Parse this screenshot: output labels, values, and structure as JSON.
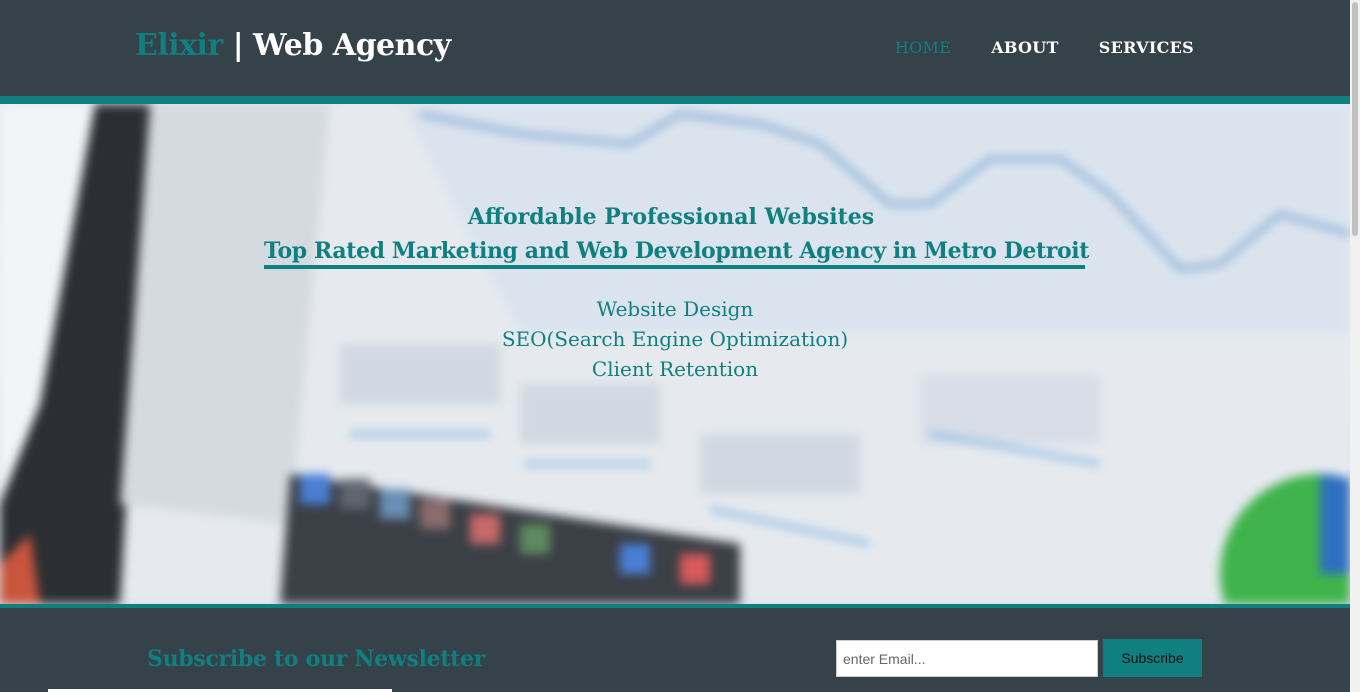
{
  "header": {
    "brand_highlight": "Elixir",
    "brand_rest": " | Web Agency",
    "nav": [
      {
        "label": "HOME",
        "active": true
      },
      {
        "label": "ABOUT",
        "active": false
      },
      {
        "label": "SERVICES",
        "active": false
      }
    ]
  },
  "hero": {
    "title": "Affordable Professional Websites",
    "subtitle": "Top Rated Marketing and Web Development Agency in Metro Detroit",
    "services": [
      "Website Design",
      "SEO(Search Engine Optimization)",
      "Client Retention"
    ]
  },
  "newsletter": {
    "title": "Subscribe to our Newsletter",
    "email_placeholder": "enter Email...",
    "subscribe_label": "Subscribe"
  },
  "colors": {
    "accent": "#0f7f7f",
    "dark": "#35424a"
  }
}
